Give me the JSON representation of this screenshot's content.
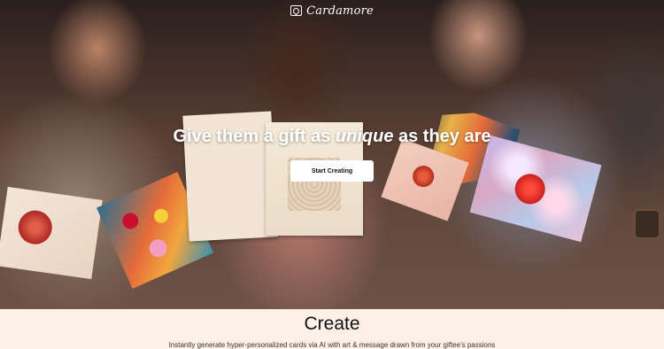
{
  "brand": {
    "name": "Cardamore",
    "icon": "card-heart-icon"
  },
  "hero": {
    "headline_before": "Give them a gift as",
    "headline_emphasis": "unique",
    "headline_after": "as they are",
    "cta_label": "Start Creating"
  },
  "section": {
    "title": "Create",
    "description": "Instantly generate hyper-personalized cards via AI with art & message drawn from your giftee's passions"
  },
  "colors": {
    "background": "#fdf1e7",
    "cta_bg": "#ffffff",
    "text_dark": "#111111"
  }
}
